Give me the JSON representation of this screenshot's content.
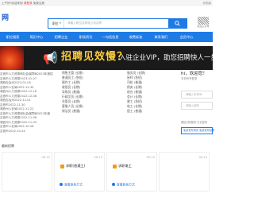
{
  "topbar": {
    "greeting": "上午好!欢迎来到",
    "login": "请登录",
    "register": "免费注册",
    "right": "手机版"
  },
  "header": {
    "logo": "网",
    "search": {
      "category": "职位",
      "placeholder": "请输入职位名称或公司名称"
    },
    "qr_label": "关注公众号"
  },
  "nav": {
    "items": [
      "职位搜索",
      "简历中心",
      "招聘企业",
      "职场资讯",
      "一句话信息",
      "收费标准",
      "联系我们",
      "会员中心"
    ]
  },
  "banner": {
    "headline": "招聘见效慢？",
    "subline": "入驻企业VIP，助您招聘快人一步"
  },
  "news": [
    "吉首市人力资源和社会保障局2023年度招",
    "吉首市人力资源2023-01-07",
    "湘西自治州2023-01-05",
    "吉首市人社局2022-12-30",
    "湘西州人力资源2022-12-16",
    "吉首市人力资源2022-12-08",
    "湘西自治州2022-12-01",
    "吉首市2022-11-30",
    "湘西州人社局2022-11-22",
    "吉首市人力资源和社会保障局2022年度",
    "吉首市人力资源2022-11-08",
    "湘西州人力资源2022-11-03",
    "吉首市人社局2022-10-28",
    "吉首市2022-10-24"
  ],
  "column_b": [
    "销售主管 (长期)",
    "普通员工 (急招)",
    "操作工 (长期)",
    "收银员 (长期)",
    "导购员 (普通)",
    "行政文员 (长期)",
    "仓管员 (长期)",
    "客服人员 (长期)",
    "保洁员 (普通)"
  ],
  "column_c": [
    "服务员 (长期)",
    "厨师 (急招)",
    "司机 (普通)",
    "保安 (长期)",
    "前台 (普通)",
    "会计 (长期)",
    "普工 (急招)",
    "电工 (长期)",
    "厨工 (普通)"
  ],
  "login": {
    "welcome": "hi，欢迎您！",
    "hint": "手机号号登录",
    "phone_placeholder": "请输入手机号",
    "password_placeholder": "请输入密码",
    "links": "微信扫码登录  忘记密码",
    "buttons": "免费发布简历  免费发布招聘"
  },
  "section_label": "最新招聘",
  "cards": [
    {
      "date": "06-15",
      "title": "",
      "contact": ""
    },
    {
      "date": "06-15",
      "title": "求职(普通工)",
      "contact": "查看联系方式"
    },
    {
      "date": "06-15",
      "title": "求职电工",
      "contact": "查看联系方式"
    },
    {
      "date": "06-15",
      "title": "",
      "contact": ""
    }
  ],
  "colors": {
    "primary": "#1e7be6",
    "accent": "#ffcf3a",
    "banner_bg": "#1a1a1a"
  }
}
